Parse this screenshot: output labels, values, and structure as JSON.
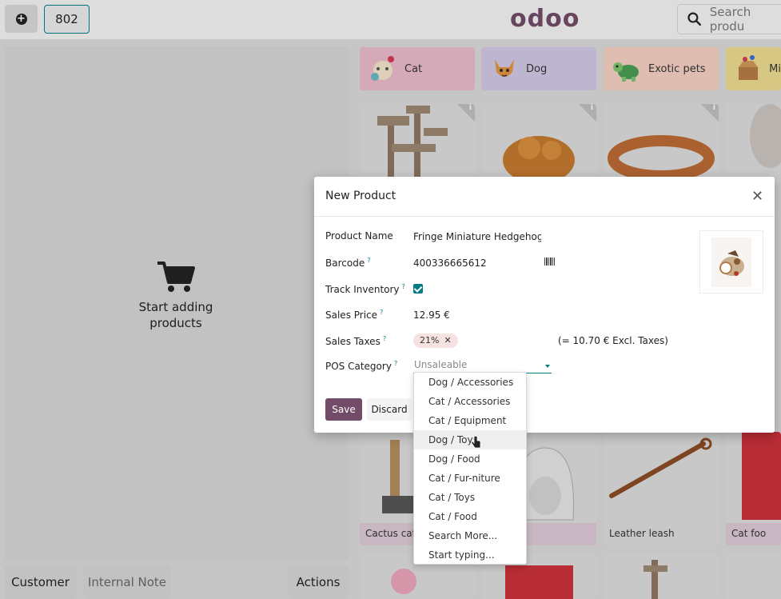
{
  "topbar": {
    "order_number": "802",
    "search_placeholder": "Search produ",
    "logo": "odoo"
  },
  "left_panel": {
    "empty_message": "Start adding products"
  },
  "bottom_buttons": {
    "customer": "Customer",
    "internal_note": "Internal Note",
    "actions": "Actions"
  },
  "categories": [
    {
      "label": "Cat",
      "color": "#e8b9c8"
    },
    {
      "label": "Dog",
      "color": "#cfc6e2"
    },
    {
      "label": "Exotic pets",
      "color": "#f2cfc0"
    },
    {
      "label": "Mi",
      "color": "#e9d98e"
    }
  ],
  "products": {
    "p1": "Cactus cat",
    "p2": "Leather leash",
    "p3": "Cat foo"
  },
  "dialog": {
    "title": "New Product",
    "fields": {
      "product_name_label": "Product Name",
      "product_name_value": "Fringe Miniature Hedgehog D",
      "barcode_label": "Barcode",
      "barcode_value": "400336665612",
      "track_inventory_label": "Track Inventory",
      "track_inventory_checked": true,
      "sales_price_label": "Sales Price",
      "sales_price_value": "12.95 €",
      "sales_taxes_label": "Sales Taxes",
      "sales_taxes_tag": "21%",
      "excl_taxes": "(= 10.70 € Excl. Taxes)",
      "pos_category_label": "POS Category",
      "pos_category_placeholder": "Unsaleable"
    },
    "help_mark": "?",
    "save_label": "Save",
    "discard_label": "Discard"
  },
  "dropdown": {
    "items": [
      "Dog / Accessories",
      "Cat / Accessories",
      "Cat / Equipment",
      "Dog / Toys",
      "Dog / Food",
      "Cat / Fur-niture",
      "Cat / Toys",
      "Cat / Food",
      "Search More...",
      "Start typing..."
    ],
    "hovered": "Dog / Toys"
  },
  "colors": {
    "primary": "#714b67",
    "accent": "#017e84"
  }
}
